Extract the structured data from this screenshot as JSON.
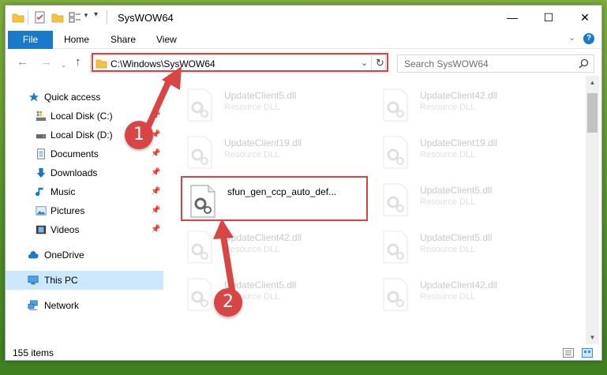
{
  "window": {
    "title": "SysWOW64",
    "controls": {
      "minimize": "—",
      "maximize": "☐",
      "close": "✕"
    }
  },
  "ribbon": {
    "tabs": [
      {
        "label": "File"
      },
      {
        "label": "Home"
      },
      {
        "label": "Share"
      },
      {
        "label": "View"
      }
    ],
    "help_glyph": "?"
  },
  "address_bar": {
    "path": "C:\\Windows\\SysWOW64"
  },
  "search": {
    "placeholder": "Search SysWOW64"
  },
  "sidebar": {
    "items": [
      {
        "label": "Quick access",
        "icon": "star-icon"
      },
      {
        "label": "Local Disk (C:)",
        "icon": "drive-icon"
      },
      {
        "label": "Local Disk (D:)",
        "icon": "drive-icon"
      },
      {
        "label": "Documents",
        "icon": "documents-icon"
      },
      {
        "label": "Downloads",
        "icon": "download-icon"
      },
      {
        "label": "Music",
        "icon": "music-icon"
      },
      {
        "label": "Pictures",
        "icon": "pictures-icon"
      },
      {
        "label": "Videos",
        "icon": "videos-icon"
      },
      {
        "label": "OneDrive",
        "icon": "cloud-icon"
      },
      {
        "label": "This PC",
        "icon": "computer-icon"
      },
      {
        "label": "Network",
        "icon": "network-icon"
      }
    ]
  },
  "files": {
    "col1": [
      {
        "name": "UpdateClient5.dll",
        "type": "Resource DLL"
      },
      {
        "name": "UpdateClient19.dll",
        "type": "Resource DLL"
      },
      {
        "name": "sfun_gen_ccp_auto_def...",
        "type": ""
      },
      {
        "name": "UpdateClient42.dll",
        "type": "Resource DLL"
      },
      {
        "name": "UpdateClient5.dll",
        "type": "Resource DLL"
      }
    ],
    "col2": [
      {
        "name": "UpdateClient42.dll",
        "type": "Resource DLL"
      },
      {
        "name": "UpdateClient19.dll",
        "type": "Resource DLL"
      },
      {
        "name": "UpdateClient5.dll",
        "type": "Resource DLL"
      },
      {
        "name": "UpdateClient5.dll",
        "type": "Resource DLL"
      },
      {
        "name": "UpdateClient42.dll",
        "type": "Resource DLL"
      }
    ]
  },
  "status": {
    "item_count": "155 items"
  },
  "annotations": {
    "step1": "1",
    "step2": "2"
  },
  "colors": {
    "file_tab": "#1979ca",
    "selection": "#cce8ff",
    "annotation_red": "#d84545",
    "folder_yellow": "#f5c242"
  }
}
